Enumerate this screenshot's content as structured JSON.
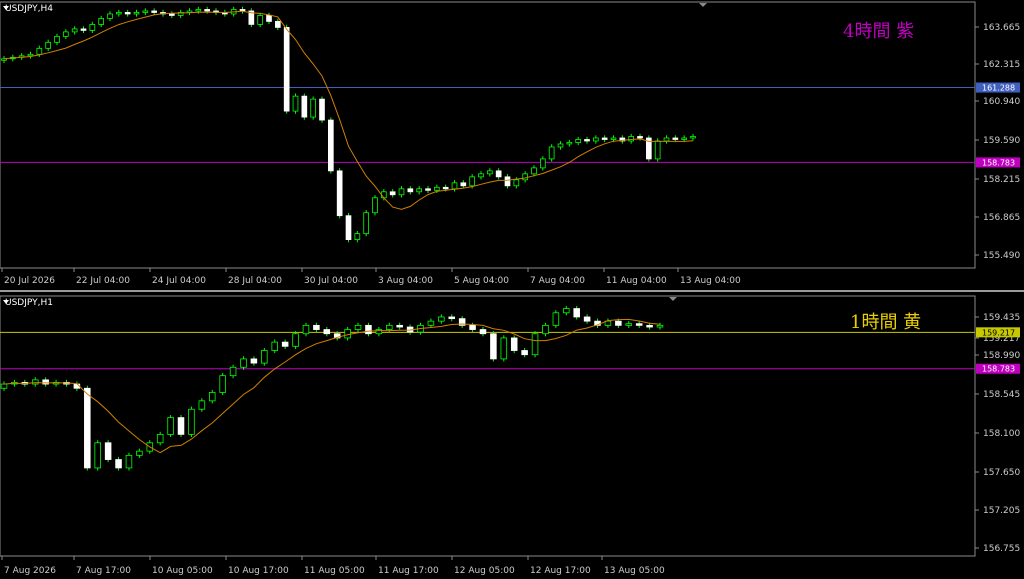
{
  "panels": [
    {
      "title": "USDJPY,H4",
      "annotation": "4時間  紫",
      "annotation_color": "#c000c0",
      "y_ticks": [
        "163.665",
        "162.315",
        "160.940",
        "159.590",
        "158.215",
        "156.865",
        "155.490"
      ],
      "x_ticks": [
        "20 Jul 2026",
        "22 Jul 04:00",
        "24 Jul 04:00",
        "28 Jul 04:00",
        "30 Jul 04:00",
        "3 Aug 04:00",
        "5 Aug 04:00",
        "7 Aug 04:00",
        "11 Aug 04:00",
        "13 Aug 04:00"
      ],
      "hlines": [
        {
          "label": "161.288",
          "value": 161.288,
          "color": "#4060c0",
          "text_color": "#ffffff"
        },
        {
          "label": "158.783",
          "value": 158.783,
          "color": "#c000c0",
          "text_color": "#ffffff"
        }
      ]
    },
    {
      "title": "USDJPY,H1",
      "annotation": "1時間  黄",
      "annotation_color": "#e8d000",
      "y_ticks": [
        "159.435",
        "159.217",
        "158.990",
        "158.545",
        "158.100",
        "157.650",
        "157.205",
        "156.755"
      ],
      "x_ticks": [
        "7 Aug 2026",
        "7 Aug 17:00",
        "10 Aug 05:00",
        "10 Aug 17:00",
        "11 Aug 05:00",
        "11 Aug 17:00",
        "12 Aug 05:00",
        "12 Aug 17:00",
        "13 Aug 05:00"
      ],
      "hlines": [
        {
          "label": "159.217",
          "value": 159.217,
          "color": "#c8c800",
          "text_color": "#000000"
        },
        {
          "label": "158.783",
          "value": 158.783,
          "color": "#c000c0",
          "text_color": "#ffffff"
        }
      ]
    }
  ],
  "chart_data": [
    {
      "type": "candlestick",
      "symbol": "USDJPY",
      "timeframe": "H4",
      "ylim": [
        155.25,
        164.15
      ],
      "moving_average_color": "#d08000",
      "candle_color": "#00ff00",
      "close_series": [
        162.25,
        162.3,
        162.35,
        162.4,
        162.6,
        162.8,
        163.0,
        163.15,
        163.25,
        163.2,
        163.4,
        163.6,
        163.75,
        163.8,
        163.75,
        163.8,
        163.85,
        163.8,
        163.75,
        163.7,
        163.8,
        163.85,
        163.9,
        163.85,
        163.8,
        163.75,
        163.9,
        163.85,
        163.4,
        163.7,
        163.5,
        163.3,
        160.5,
        161.0,
        160.3,
        160.9,
        160.2,
        158.5,
        157.0,
        156.2,
        156.4,
        157.1,
        157.6,
        157.8,
        157.7,
        157.9,
        157.8,
        157.9,
        157.85,
        157.95,
        157.9,
        158.1,
        158.0,
        158.3,
        158.4,
        158.5,
        158.3,
        158.0,
        158.2,
        158.4,
        158.6,
        158.9,
        159.3,
        159.4,
        159.45,
        159.55,
        159.5,
        159.6,
        159.55,
        159.6,
        159.5,
        159.65,
        159.6,
        158.9,
        159.5,
        159.6,
        159.55,
        159.6,
        159.65
      ],
      "annotations": [
        "161.288",
        "158.783"
      ]
    },
    {
      "type": "candlestick",
      "symbol": "USDJPY",
      "timeframe": "H1",
      "ylim": [
        156.55,
        159.65
      ],
      "moving_average_color": "#d08000",
      "candle_color": "#00ff00",
      "close_series": [
        158.6,
        158.62,
        158.6,
        158.65,
        158.6,
        158.62,
        158.6,
        158.55,
        157.6,
        157.9,
        157.7,
        157.6,
        157.75,
        157.8,
        157.9,
        158.0,
        158.2,
        158.0,
        158.3,
        158.4,
        158.5,
        158.7,
        158.8,
        158.9,
        158.85,
        159.0,
        159.1,
        159.05,
        159.2,
        159.3,
        159.25,
        159.2,
        159.15,
        159.25,
        159.3,
        159.2,
        159.25,
        159.3,
        159.28,
        159.22,
        159.3,
        159.35,
        159.4,
        159.38,
        159.3,
        159.25,
        159.2,
        158.9,
        159.15,
        159.0,
        158.95,
        159.2,
        159.3,
        159.45,
        159.5,
        159.4,
        159.35,
        159.3,
        159.35,
        159.3,
        159.32,
        159.3,
        159.28,
        159.3
      ]
    }
  ]
}
